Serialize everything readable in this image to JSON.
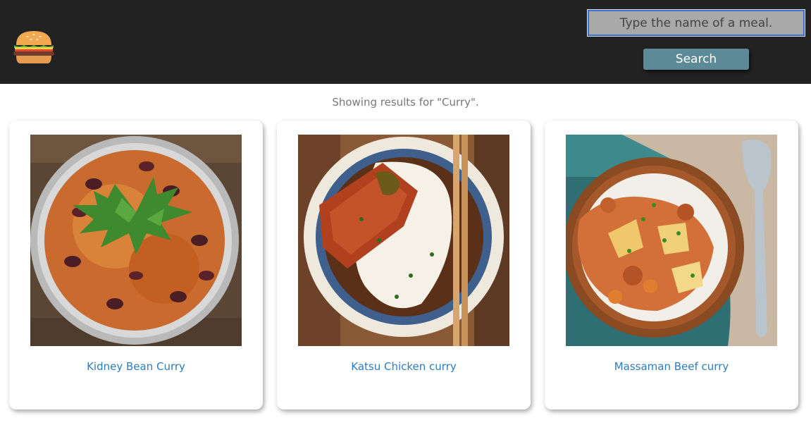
{
  "header": {
    "logo_icon": "burger-icon",
    "background": "#222222"
  },
  "search": {
    "placeholder": "Type the name of a meal.",
    "value": "",
    "button_label": "Search",
    "button_color": "#5d8a97"
  },
  "results": {
    "note": "Showing results for \"Curry\".",
    "items": [
      {
        "title": "Kidney Bean Curry",
        "image": "kidney-bean-curry-photo"
      },
      {
        "title": "Katsu Chicken curry",
        "image": "katsu-chicken-curry-photo"
      },
      {
        "title": "Massaman Beef curry",
        "image": "massaman-beef-curry-photo"
      }
    ],
    "link_color": "#2c7cc2"
  }
}
